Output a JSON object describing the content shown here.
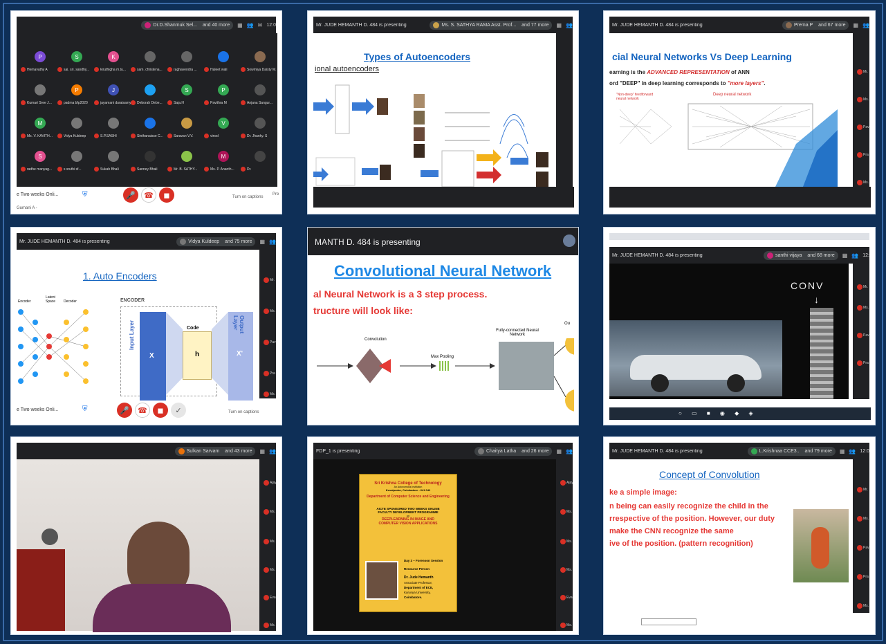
{
  "tile1": {
    "pin_name": "Dr.D.Shanmuk Sel...",
    "pin_count": "and 40 more",
    "time": "12:0",
    "participants": [
      {
        "initial": "P",
        "name": "Hemavathy A",
        "color": "#7b4bd6"
      },
      {
        "initial": "S",
        "name": "sai. sri. sandhy...",
        "color": "#34a853"
      },
      {
        "initial": "K",
        "name": "kiruthigha m.tu...",
        "color": "#e3508f"
      },
      {
        "initial": "",
        "name": "sam. christena...",
        "color": "#666"
      },
      {
        "initial": "",
        "name": "raghavendra ...",
        "color": "#666"
      },
      {
        "initial": "",
        "name": "Haleet wali",
        "color": "#1a73e8"
      },
      {
        "initial": "",
        "name": "Sowmiya Daisty M.",
        "color": "#8a6a50"
      },
      {
        "initial": "",
        "name": "Kumari Sree J...",
        "color": "#777"
      },
      {
        "initial": "P",
        "name": "padma bfp2020",
        "color": "#f57c00"
      },
      {
        "initial": "J",
        "name": "jayamani duraisamy",
        "color": "#3f51b5"
      },
      {
        "initial": "",
        "name": "Deborah Debe...",
        "color": "#1da1f2"
      },
      {
        "initial": "S",
        "name": "Saja.H",
        "color": "#34a853"
      },
      {
        "initial": "P",
        "name": "Pavithra M",
        "color": "#34a853"
      },
      {
        "initial": "",
        "name": "Anjana Sangur...",
        "color": "#555"
      },
      {
        "initial": "M",
        "name": "Ms. V. KAVITH...",
        "color": "#34a853"
      },
      {
        "initial": "",
        "name": "Vidya Kuldeep",
        "color": "#777"
      },
      {
        "initial": "",
        "name": "S.P.SASHI",
        "color": "#777"
      },
      {
        "initial": "",
        "name": "Sinthanaisse C...",
        "color": "#1a73e8"
      },
      {
        "initial": "",
        "name": "Saravan V.V.",
        "color": "#c89a44"
      },
      {
        "initial": "V",
        "name": "vinod",
        "color": "#34a853"
      },
      {
        "initial": "",
        "name": "Dr. Jhanky. S",
        "color": "#555"
      },
      {
        "initial": "S",
        "name": "radhe manyag...",
        "color": "#e3508f"
      },
      {
        "initial": "",
        "name": "s sruthi sf...",
        "color": "#777"
      },
      {
        "initial": "",
        "name": "Sukah Bhali",
        "color": "#777"
      },
      {
        "initial": "",
        "name": "Sanney Bhali",
        "color": "#333"
      },
      {
        "initial": "",
        "name": "Mr. B. SATHY...",
        "color": "#8bc34a"
      },
      {
        "initial": "M",
        "name": "Ms. P. Ananth...",
        "color": "#ad1457"
      },
      {
        "initial": "",
        "name": "Dr.",
        "color": "#444"
      }
    ],
    "meeting_name": "e Two weeks Onli...",
    "captions_label": "Turn on captions",
    "present_label": "Pre",
    "tray": "Gumani A -"
  },
  "tile2": {
    "presenter": "Mr. JUDE HEMANTH D. 484 is presenting",
    "pin_name": "Ms. S. SATHYA RAMA Asst. Prof...",
    "pin_count": "and 77 more",
    "title": "Types of Autoencoders",
    "subtitle": "ional autoencoders"
  },
  "tile3": {
    "presenter": "Mr. JUDE HEMANTH D. 484 is presenting",
    "pin_name": "Prema P",
    "pin_count": "and 67 more",
    "title": "cial Neural Networks Vs Deep Learning",
    "line1_a": "earning is the ",
    "line1_b": "ADVANCED REPRESENTATION",
    "line1_c": " of ANN",
    "line2_a": "ord \"DEEP\" in deep learning corresponds to ",
    "line2_b": "\"more layers\"",
    "line2_c": ".",
    "left_net": "\"Non-deep\" feedforward neural network",
    "right_net": "Deep neural network",
    "side_names": [
      "Mr.",
      "Ms.",
      "Pav",
      "Pra",
      "Ms."
    ]
  },
  "tile4": {
    "presenter": "Mr. JUDE HEMANTH D. 484 is presenting",
    "pin_name": "Vidya Kuldeep",
    "pin_count": "and 75 more",
    "title": "1. Auto Encoders",
    "encoder": "ENCODER",
    "code": "Code",
    "input_layer": "Input Layer",
    "output_layer": "Output Layer",
    "x": "X",
    "h": "h",
    "xp": "X'",
    "enc_label": "Encoder",
    "latent": "Latent Space",
    "dec_label": "Decoder",
    "meeting_name": "e Two weeks Onli...",
    "captions_label": "Turn on captions",
    "side_names": [
      "Mr.",
      "Ms.",
      "Pav",
      "Pra",
      "Ms."
    ]
  },
  "tile5": {
    "presenter": "MANTH D. 484 is presenting",
    "title": "Convolutional Neural Network",
    "line1": "al Neural Network is a 3 step process.",
    "line2": "tructure will look like:",
    "conv": "Convolution",
    "pool": "Max Pooling",
    "fc": "Fully-connected Neural Network",
    "out": "Ou"
  },
  "tile6": {
    "presenter": "Mr. JUDE HEMANTH D. 484 is presenting",
    "pin_name": "santhi vijaya",
    "pin_count": "and 68 more",
    "slide_text": "CONV",
    "time": "12:",
    "side_names": [
      "Mr.",
      "Ms.",
      "Pav",
      "Pra"
    ]
  },
  "tile7": {
    "pin_name": "Sulkan Sarvam",
    "pin_count": "and 43 more",
    "side_names": [
      "Ajay",
      "Ms.",
      "Ms.",
      "Ms.",
      "Eva",
      "Ms."
    ]
  },
  "tile8": {
    "presenter": "FDP_1 is presenting",
    "pin_name": "Chaitya Latha",
    "pin_count": "and 26 more",
    "college": "Sri Krishna College of Technology",
    "college_sub": "An Autonomous Institution",
    "place": "Kovaipudur, Coimbatore - 641 042",
    "dept": "Department of Computer Science and Engineering",
    "program1": "AICTE SPONSORED TWO WEEKS ONLINE",
    "program2": "FACULTY DEVELOPMENT PROGRAMME",
    "program3": "on",
    "program4": "DEEPLEARNING IN IMAGE AND",
    "program5": "COMPUTER VISION APPLICATIONS",
    "day": "Day 3 – Forenoon Session",
    "rp": "Resource Person",
    "person": "Dr. Jude Hemanth",
    "role1": "Associate Professor,",
    "role2": "Department of ECE,",
    "role3": "Karunya University,",
    "role4": "Coimbatore.",
    "side_names": [
      "Ajay",
      "Ms.",
      "Ms.",
      "Ms.",
      "Eva",
      "Ms."
    ]
  },
  "tile9": {
    "presenter": "Mr. JUDE HEMANTH D. 484 is presenting",
    "pin_name": "L.Krishnaa CCE3..",
    "pin_count": "and 79 more",
    "time": "12:0",
    "title": "Concept of Convolution",
    "line1": "ke a simple image:",
    "line2": "n being can easily recognize the child in the",
    "line3": "rrespective of the position. However, our duty",
    "line4": "make the CNN recognize the same",
    "line5": "ive of the position. (pattern recognition)",
    "side_names": [
      "Mr.",
      "Ms.",
      "Pav",
      "Pra",
      "Ms."
    ]
  }
}
